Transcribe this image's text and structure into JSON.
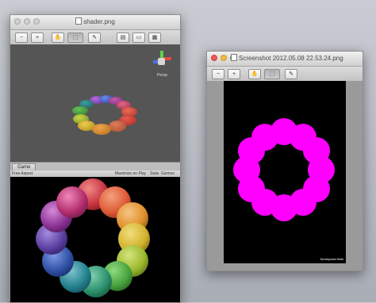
{
  "window_left": {
    "title": "shader.png",
    "toolbar_icons": [
      "zoom-out-icon",
      "zoom-in-icon",
      "hand-icon",
      "select-icon",
      "pencil-icon",
      "sidebar-icon",
      "thumbnail-icon",
      "grid-icon"
    ],
    "scene": {
      "view_label": "Persp"
    },
    "game": {
      "tab_label": "Game",
      "aspect": "Free Aspect",
      "maximize_label": "Maximize on Play",
      "stats_label": "Stats",
      "gizmos_label": "Gizmos"
    }
  },
  "window_right": {
    "title": "Screenshot 2012.05.08 22.53.24.png",
    "toolbar_icons": [
      "zoom-out-icon",
      "zoom-in-icon",
      "hand-icon",
      "select-icon",
      "pencil-icon"
    ],
    "dev_build_label": "Development Build"
  },
  "colors": {
    "magenta": "#ff00ff",
    "ball_hues": [
      "#cc2b38",
      "#e05a33",
      "#e0902a",
      "#d9b82f",
      "#a6bf2c",
      "#5fa83a",
      "#2f8a5c",
      "#24807d",
      "#2d5c9b",
      "#4b3e91",
      "#7a2d8e",
      "#a82a6a"
    ]
  }
}
